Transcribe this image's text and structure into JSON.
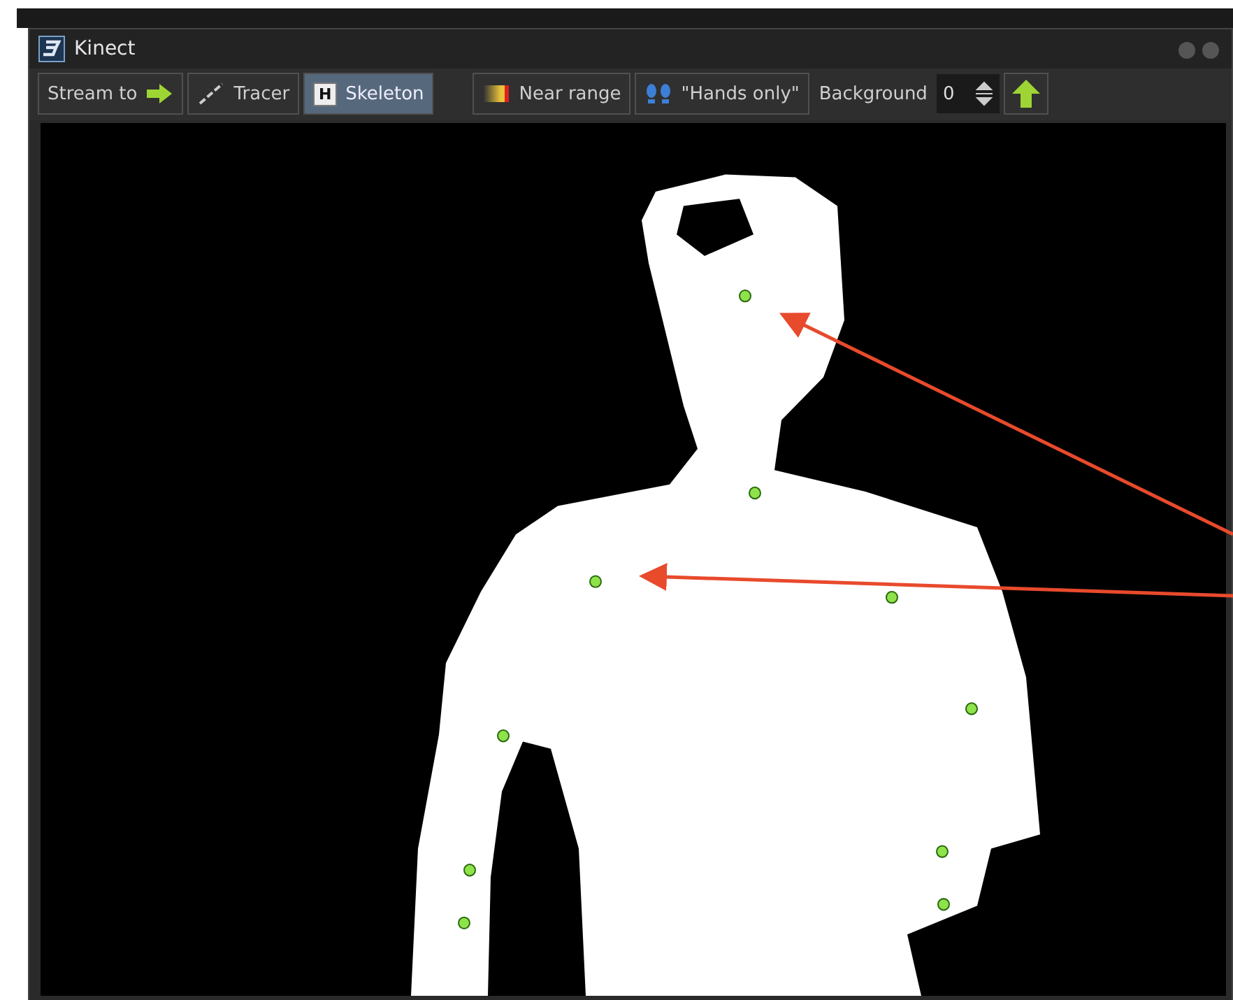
{
  "window": {
    "title": "Kinect"
  },
  "toolbar": {
    "buttons": [
      {
        "kind": "stream",
        "label": "Stream to",
        "selected": false
      },
      {
        "kind": "tracer",
        "label": "Tracer",
        "selected": false
      },
      {
        "kind": "skeleton",
        "label": "Skeleton",
        "icon": "H",
        "selected": true
      },
      {
        "kind": "near",
        "label": "Near range",
        "selected": false
      },
      {
        "kind": "hands",
        "label": "\"Hands only\"",
        "selected": false
      }
    ],
    "background": {
      "label": "Background",
      "value": "0"
    }
  }
}
